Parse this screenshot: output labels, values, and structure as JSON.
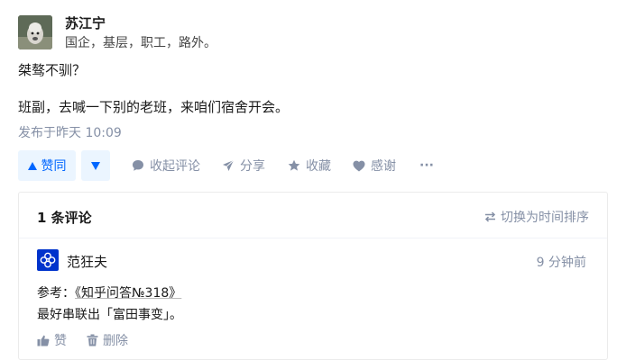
{
  "author": {
    "name": "苏江宁",
    "bio": "国企，基层，职工，路外。"
  },
  "answer": {
    "paragraphs": [
      "桀骜不驯？",
      "班副，去喊一下别的老班，来咱们宿舍开会。"
    ],
    "published": "发布于昨天 10:09"
  },
  "actions": {
    "vote_up": "赞同",
    "collapse_comments": "收起评论",
    "share": "分享",
    "favorite": "收藏",
    "thanks": "感谢",
    "more": "···"
  },
  "comments": {
    "count_label": "1 条评论",
    "sort_label": "切换为时间排序",
    "items": [
      {
        "author": "范狂夫",
        "time": "9 分钟前",
        "line1_prefix": "参考：",
        "line1_link": "《知乎问答№318》",
        "line2": "最好串联出「富田事变」。",
        "like": "赞",
        "delete": "删除"
      }
    ]
  },
  "colors": {
    "accent": "#0066ff",
    "accent_bg": "#ebf5ff",
    "muted": "#8590a6",
    "comment_avatar": "#0033cc"
  }
}
